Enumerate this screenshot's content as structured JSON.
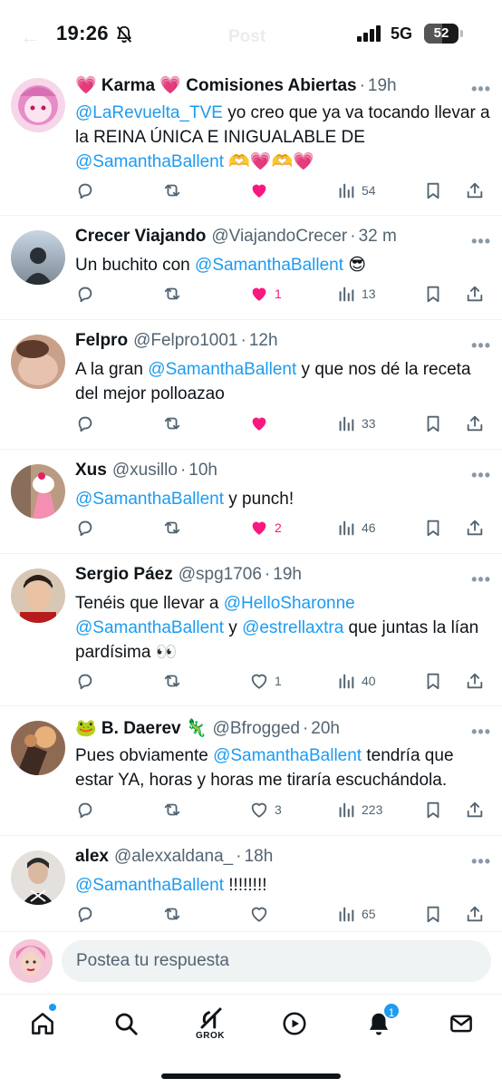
{
  "status_bar": {
    "time": "19:26",
    "network": "5G",
    "battery": "52",
    "battery_level_percent": 52,
    "header_title": "Post"
  },
  "colors": {
    "accent": "#1d9bf0",
    "like": "#f91880",
    "secondary_text": "#536471"
  },
  "tweets": [
    {
      "name": "💗 Karma 💗 Comisiones Abiertas",
      "handle": "",
      "time": "19h",
      "text_parts": [
        {
          "t": "@LaRevuelta_TVE",
          "m": true
        },
        {
          "t": " yo creo que ya va tocando llevar a la REINA ÚNICA E INIGUALABLE DE ",
          "m": false
        },
        {
          "t": "@SamanthaBallent",
          "m": true
        },
        {
          "t": " 🫶💗🫶💗",
          "m": false
        }
      ],
      "liked": true,
      "likes": "",
      "views": "54"
    },
    {
      "name": "Crecer Viajando",
      "handle": "@ViajandoCrecer",
      "time": "32 m",
      "text_parts": [
        {
          "t": "Un buchito con ",
          "m": false
        },
        {
          "t": "@SamanthaBallent",
          "m": true
        },
        {
          "t": " 😎",
          "m": false
        }
      ],
      "liked": true,
      "likes": "1",
      "views": "13"
    },
    {
      "name": "Felpro",
      "handle": "@Felpro1001",
      "time": "12h",
      "text_parts": [
        {
          "t": "A la gran ",
          "m": false
        },
        {
          "t": "@SamanthaBallent",
          "m": true
        },
        {
          "t": " y que nos dé la receta del mejor polloazao",
          "m": false
        }
      ],
      "liked": true,
      "likes": "",
      "views": "33"
    },
    {
      "name": "Xus",
      "handle": "@xusillo",
      "time": "10h",
      "text_parts": [
        {
          "t": "@SamanthaBallent",
          "m": true
        },
        {
          "t": " y punch!",
          "m": false
        }
      ],
      "liked": true,
      "likes": "2",
      "views": "46"
    },
    {
      "name": "Sergio Páez",
      "handle": "@spg1706",
      "time": "19h",
      "text_parts": [
        {
          "t": "Tenéis que llevar a ",
          "m": false
        },
        {
          "t": "@HelloSharonne",
          "m": true
        },
        {
          "t": " ",
          "m": false
        },
        {
          "t": "@SamanthaBallent",
          "m": true
        },
        {
          "t": " y ",
          "m": false
        },
        {
          "t": "@estrellaxtra",
          "m": true
        },
        {
          "t": "  que juntas la lían pardísima 👀",
          "m": false
        }
      ],
      "liked": false,
      "likes": "1",
      "views": "40"
    },
    {
      "name": "🐸 B. Daerev 🦎",
      "handle": "@Bfrogged",
      "time": "20h",
      "text_parts": [
        {
          "t": "Pues obviamente ",
          "m": false
        },
        {
          "t": "@SamanthaBallent",
          "m": true
        },
        {
          "t": " tendría que estar YA, horas y horas me tiraría escuchándola.",
          "m": false
        }
      ],
      "liked": false,
      "likes": "3",
      "views": "223"
    },
    {
      "name": "alex",
      "handle": "@alexxaldana_",
      "time": "18h",
      "text_parts": [
        {
          "t": "@SamanthaBallent",
          "m": true
        },
        {
          "t": " !!!!!!!!",
          "m": false
        }
      ],
      "liked": false,
      "likes": "",
      "views": "65"
    }
  ],
  "reply": {
    "placeholder": "Postea tu respuesta"
  },
  "nav": {
    "grok_label": "GROK",
    "notifications_badge": "1"
  }
}
